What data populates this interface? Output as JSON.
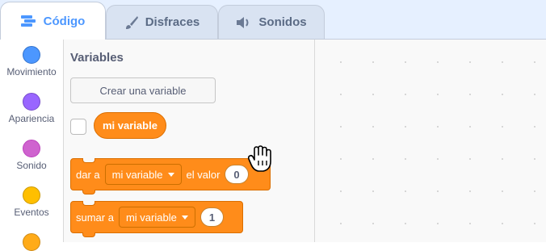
{
  "tabs": [
    {
      "label": "Código",
      "icon": "code-icon",
      "active": true
    },
    {
      "label": "Disfraces",
      "icon": "brush-icon",
      "active": false
    },
    {
      "label": "Sonidos",
      "icon": "speaker-icon",
      "active": false
    }
  ],
  "categories": [
    {
      "label": "Movimiento",
      "color": "#4c97ff"
    },
    {
      "label": "Apariencia",
      "color": "#9966ff"
    },
    {
      "label": "Sonido",
      "color": "#cf63cf"
    },
    {
      "label": "Eventos",
      "color": "#ffbf00"
    },
    {
      "label": "",
      "color": "#ffab19"
    }
  ],
  "palette": {
    "title": "Variables",
    "create_variable": "Crear una variable",
    "reporter_label": "mi variable",
    "set_block": {
      "prefix": "dar a",
      "variable": "mi variable",
      "middle": "el valor",
      "value": "0"
    },
    "change_block": {
      "prefix": "sumar a",
      "variable": "mi variable",
      "value": "1"
    }
  },
  "colors": {
    "variables": "#ff8c1a",
    "accent": "#4c97ff"
  }
}
